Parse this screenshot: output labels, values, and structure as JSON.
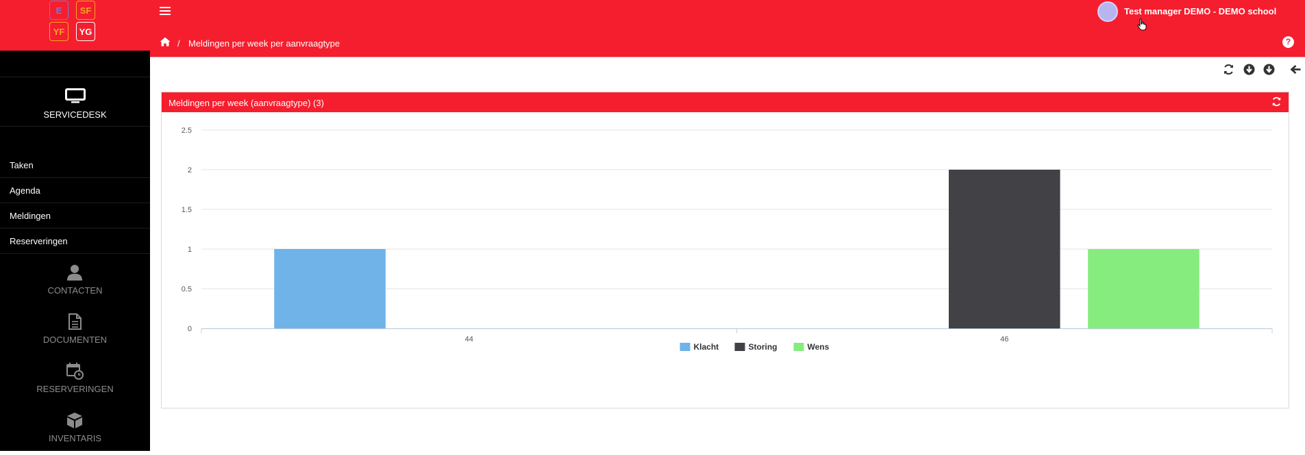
{
  "sidebar": {
    "tiles": [
      "E",
      "SF",
      "YF",
      "YG"
    ],
    "current_module": {
      "label": "SERVICEDESK",
      "icon": "monitor-icon"
    },
    "links": [
      "Taken",
      "Agenda",
      "Meldingen",
      "Reserveringen"
    ],
    "modules": [
      {
        "label": "CONTACTEN",
        "icon": "user-icon"
      },
      {
        "label": "DOCUMENTEN",
        "icon": "document-icon"
      },
      {
        "label": "RESERVERINGEN",
        "icon": "calendar-clock-icon"
      },
      {
        "label": "INVENTARIS",
        "icon": "box-icon"
      }
    ]
  },
  "topbar": {
    "user_name": "Test manager DEMO - DEMO school",
    "breadcrumb_separator": "/",
    "breadcrumb_title": "Meldingen per week per aanvraagtype",
    "help_label": "?"
  },
  "panel": {
    "title": "Meldingen per week (aanvraagtype) (3)"
  },
  "colors": {
    "brand": "#f51e2e",
    "klacht": "#6fb3e8",
    "storing": "#414146",
    "wens": "#86ec7e"
  },
  "chart_data": {
    "type": "bar",
    "categories": [
      "44",
      "46"
    ],
    "series": [
      {
        "name": "Klacht",
        "values": [
          1,
          0
        ]
      },
      {
        "name": "Storing",
        "values": [
          0,
          2
        ]
      },
      {
        "name": "Wens",
        "values": [
          0,
          1
        ]
      }
    ],
    "ylim": [
      0,
      2.5
    ],
    "yticks": [
      "0",
      "0.5",
      "1",
      "1.5",
      "2",
      "2.5"
    ],
    "grid": true,
    "legend": "bottom-center"
  }
}
